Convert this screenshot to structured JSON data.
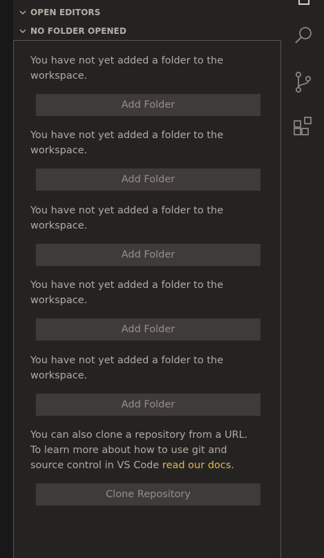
{
  "sidebar": {
    "sections": {
      "open_editors": "OPEN EDITORS",
      "no_folder": "NO FOLDER OPENED"
    },
    "empty_message": "You have not yet added a folder to the workspace.",
    "add_folder_label": "Add Folder",
    "clone_message_prefix": "You can also clone a repository from a URL. To learn more about how to use git and source control in VS Code ",
    "clone_message_link": "read our docs",
    "clone_message_suffix": ".",
    "clone_button_label": "Clone Repository"
  },
  "activity_bar": {
    "items": [
      {
        "icon": "files-icon"
      },
      {
        "icon": "search-icon"
      },
      {
        "icon": "source-control-icon"
      },
      {
        "icon": "extensions-icon"
      }
    ]
  },
  "colors": {
    "link": "#e5b64d",
    "button_bg": "#403b3b",
    "panel_border": "#595552"
  }
}
